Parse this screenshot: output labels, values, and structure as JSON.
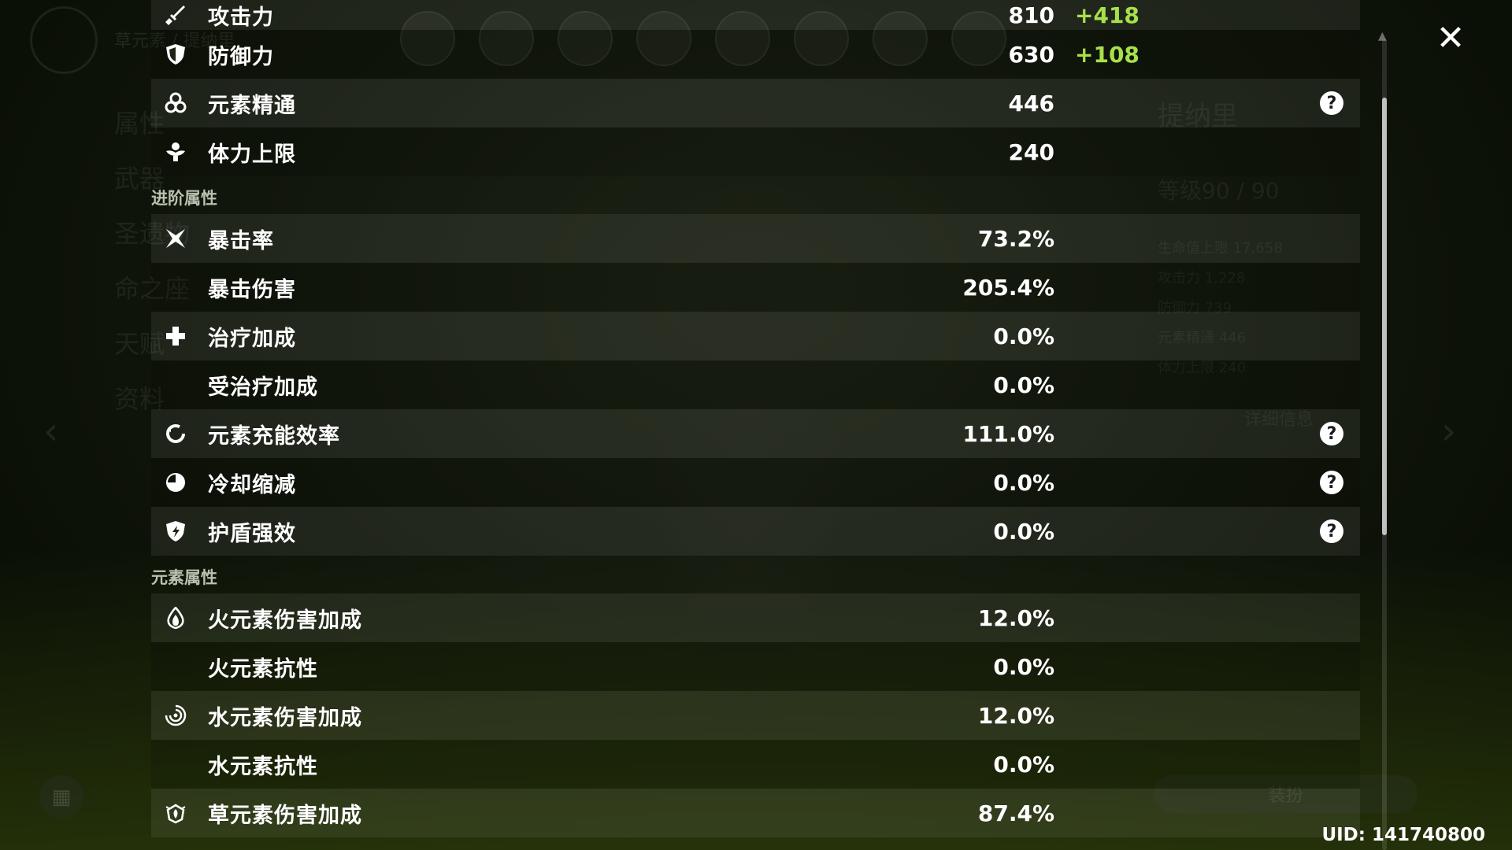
{
  "background": {
    "breadcrumb": "草元素 / 提纳里",
    "side_menu": [
      "属性",
      "武器",
      "圣遗物",
      "命之座",
      "天赋",
      "资料"
    ],
    "character_name": "提纳里",
    "level_text": "等级90 / 90",
    "mini_stats": [
      "生命值上限 17,658",
      "攻击力 1,228",
      "防御力 739",
      "元素精通 446",
      "体力上限 240"
    ],
    "details_button": "详细信息",
    "outfit_button": "装扮"
  },
  "stats": {
    "base": [
      {
        "icon": "sword-icon",
        "label": "攻击力",
        "value": "810",
        "bonus": "+418",
        "help": false
      },
      {
        "icon": "shield-icon",
        "label": "防御力",
        "value": "630",
        "bonus": "+108",
        "help": false
      },
      {
        "icon": "elemental-mastery-icon",
        "label": "元素精通",
        "value": "446",
        "bonus": "",
        "help": true
      },
      {
        "icon": "stamina-icon",
        "label": "体力上限",
        "value": "240",
        "bonus": "",
        "help": false
      }
    ],
    "advanced_title": "进阶属性",
    "advanced": [
      {
        "icon": "crit-rate-icon",
        "label": "暴击率",
        "value": "73.2%",
        "help": false
      },
      {
        "icon": "",
        "label": "暴击伤害",
        "value": "205.4%",
        "help": false
      },
      {
        "icon": "healing-bonus-icon",
        "label": "治疗加成",
        "value": "0.0%",
        "help": false
      },
      {
        "icon": "",
        "label": "受治疗加成",
        "value": "0.0%",
        "help": false
      },
      {
        "icon": "energy-recharge-icon",
        "label": "元素充能效率",
        "value": "111.0%",
        "help": true
      },
      {
        "icon": "cd-reduction-icon",
        "label": "冷却缩减",
        "value": "0.0%",
        "help": true
      },
      {
        "icon": "shield-strength-icon",
        "label": "护盾强效",
        "value": "0.0%",
        "help": true
      }
    ],
    "elemental_title": "元素属性",
    "elemental": [
      {
        "icon": "pyro-icon",
        "label": "火元素伤害加成",
        "value": "12.0%"
      },
      {
        "icon": "",
        "label": "火元素抗性",
        "value": "0.0%"
      },
      {
        "icon": "hydro-icon",
        "label": "水元素伤害加成",
        "value": "12.0%"
      },
      {
        "icon": "",
        "label": "水元素抗性",
        "value": "0.0%"
      },
      {
        "icon": "dendro-icon",
        "label": "草元素伤害加成",
        "value": "87.4%"
      }
    ]
  },
  "help_glyph": "?",
  "close_glyph": "✕",
  "uid": "UID: 141740800",
  "colors": {
    "bonus": "#a8e04a",
    "accent": "#ffffff"
  }
}
